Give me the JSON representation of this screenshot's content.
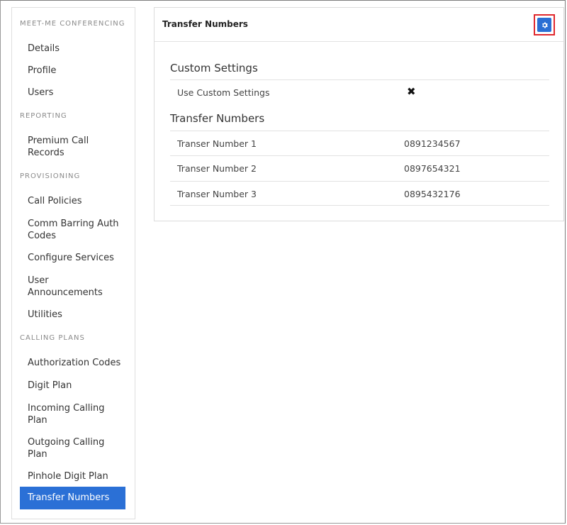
{
  "sidebar": {
    "sections": [
      {
        "title": "MEET-ME CONFERENCING"
      },
      {
        "title": "REPORTING"
      },
      {
        "title": "PROVISIONING"
      },
      {
        "title": "CALLING PLANS"
      }
    ],
    "items": [
      "Details",
      "Profile",
      "Users",
      "Premium Call\nRecords",
      "Call Policies",
      "Comm Barring Auth\nCodes",
      "Configure Services",
      "User\nAnnouncements",
      "Utilities",
      "Authorization Codes",
      "Digit Plan",
      "Incoming Calling\nPlan",
      "Outgoing Calling\nPlan",
      "Pinhole Digit Plan",
      "Transfer Numbers"
    ],
    "active_item": "Transfer Numbers",
    "accent_color": "#2b70d6"
  },
  "panel": {
    "title": "Transfer Numbers",
    "settings_icon": "gear-icon",
    "highlight_color": "#e0282e",
    "custom_settings": {
      "heading": "Custom Settings",
      "rows": [
        {
          "label": "Use Custom Settings",
          "value_icon": "x-icon",
          "value_symbol": "✖"
        }
      ]
    },
    "transfer_numbers": {
      "heading": "Transfer Numbers",
      "rows": [
        {
          "label": "Transer Number 1",
          "value": "0891234567"
        },
        {
          "label": "Transer Number 2",
          "value": "0897654321"
        },
        {
          "label": "Transer Number 3",
          "value": "0895432176"
        }
      ]
    }
  }
}
